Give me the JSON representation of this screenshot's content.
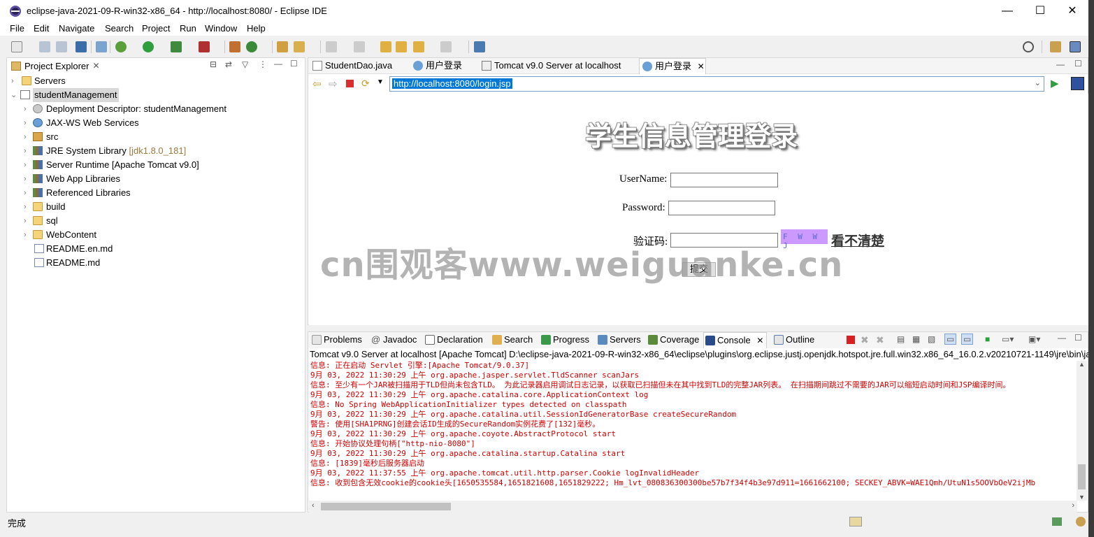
{
  "window": {
    "title": "eclipse-java-2021-09-R-win32-x86_64 - http://localhost:8080/ - Eclipse IDE",
    "controls": {
      "minimize": "—",
      "maximize": "☐",
      "close": "✕"
    }
  },
  "menu": [
    "File",
    "Edit",
    "Navigate",
    "Search",
    "Project",
    "Run",
    "Window",
    "Help"
  ],
  "project_explorer": {
    "title": "Project Explorer",
    "items": [
      {
        "label": "Servers",
        "depth": 0,
        "icon": "folder-icon"
      },
      {
        "label": "studentManagement",
        "depth": 0,
        "icon": "project-icon",
        "expanded": true,
        "selected": true
      },
      {
        "label": "Deployment Descriptor: studentManagement",
        "depth": 1,
        "icon": "descriptor-icon"
      },
      {
        "label": "JAX-WS Web Services",
        "depth": 1,
        "icon": "webservice-icon"
      },
      {
        "label": "src",
        "depth": 1,
        "icon": "package-icon"
      },
      {
        "label": "JRE System Library",
        "deco": "[jdk1.8.0_181]",
        "depth": 1,
        "icon": "library-icon"
      },
      {
        "label": "Server Runtime [Apache Tomcat v9.0]",
        "depth": 1,
        "icon": "library-icon"
      },
      {
        "label": "Web App Libraries",
        "depth": 1,
        "icon": "library-icon"
      },
      {
        "label": "Referenced Libraries",
        "depth": 1,
        "icon": "library-icon"
      },
      {
        "label": "build",
        "depth": 1,
        "icon": "folder-icon"
      },
      {
        "label": "sql",
        "depth": 1,
        "icon": "folder-icon"
      },
      {
        "label": "WebContent",
        "depth": 1,
        "icon": "folder-icon"
      },
      {
        "label": "README.en.md",
        "depth": 1,
        "icon": "file-icon",
        "leaf": true
      },
      {
        "label": "README.md",
        "depth": 1,
        "icon": "file-icon",
        "leaf": true
      }
    ]
  },
  "editor_tabs": [
    {
      "label": "StudentDao.java",
      "icon": "java-file-icon"
    },
    {
      "label": "用户登录",
      "icon": "globe-icon"
    },
    {
      "label": "Tomcat v9.0 Server at localhost",
      "icon": "server-icon"
    },
    {
      "label": "用户登录",
      "icon": "globe-icon",
      "active": true,
      "close": "✕"
    }
  ],
  "browser": {
    "url": "http://localhost:8080/login.jsp"
  },
  "login_page": {
    "heading": "学生信息管理登录",
    "username_label": "UserName:",
    "password_label": "Password:",
    "captcha_label": "验证码:",
    "captcha_image_text": "F W W J",
    "captcha_refresh": "看不清楚",
    "submit": "提交"
  },
  "watermark": "cn围观客www.weiguanke.cn",
  "bottom_tabs": [
    {
      "label": "Problems",
      "icon": "problems-icon"
    },
    {
      "label": "Javadoc",
      "icon": "javadoc-icon"
    },
    {
      "label": "Declaration",
      "icon": "declaration-icon"
    },
    {
      "label": "Search",
      "icon": "search-icon"
    },
    {
      "label": "Progress",
      "icon": "progress-icon"
    },
    {
      "label": "Servers",
      "icon": "servers-icon"
    },
    {
      "label": "Coverage",
      "icon": "coverage-icon"
    },
    {
      "label": "Console",
      "icon": "console-icon",
      "active": true,
      "close": "✕"
    },
    {
      "label": "Outline",
      "icon": "outline-icon"
    }
  ],
  "console": {
    "description": "Tomcat v9.0 Server at localhost [Apache Tomcat] D:\\eclipse-java-2021-09-R-win32-x86_64\\eclipse\\plugins\\org.eclipse.justj.openjdk.hotspot.jre.full.win32.x86_64_16.0.2.v20210721-1149\\jre\\bin\\ja",
    "lines": [
      "信息: 正在启动 Servlet 引擎:[Apache Tomcat/9.0.37]",
      "9月 03, 2022 11:30:29 上午 org.apache.jasper.servlet.TldScanner scanJars",
      "信息: 至少有一个JAR被扫描用于TLD但尚未包含TLD。 为此记录器启用调试日志记录，以获取已扫描但未在其中找到TLD的完整JAR列表。 在扫描期间跳过不需要的JAR可以缩短启动时间和JSP编译时间。",
      "9月 03, 2022 11:30:29 上午 org.apache.catalina.core.ApplicationContext log",
      "信息: No Spring WebApplicationInitializer types detected on classpath",
      "9月 03, 2022 11:30:29 上午 org.apache.catalina.util.SessionIdGeneratorBase createSecureRandom",
      "警告: 使用[SHA1PRNG]创建会话ID生成的SecureRandom实例花费了[132]毫秒。",
      "9月 03, 2022 11:30:29 上午 org.apache.coyote.AbstractProtocol start",
      "信息: 开始协议处理句柄[\"http-nio-8080\"]",
      "9月 03, 2022 11:30:29 上午 org.apache.catalina.startup.Catalina start",
      "信息: [1839]毫秒后服务器启动",
      "9月 03, 2022 11:37:55 上午 org.apache.tomcat.util.http.parser.Cookie logInvalidHeader",
      "信息: 收到包含无效cookie的cookie头[1650535584,1651821608,1651829222; Hm_lvt_080836300300be57b7f34f4b3e97d911=1661662100; SECKEY_ABVK=WAE1Qmh/UtuN1s5OOVbOeV2ijMb"
    ]
  },
  "status": {
    "text": "完成"
  },
  "colors": {
    "console_text": "#d00000",
    "selection": "#0078d7",
    "captcha_bg": "#cc99ff"
  }
}
